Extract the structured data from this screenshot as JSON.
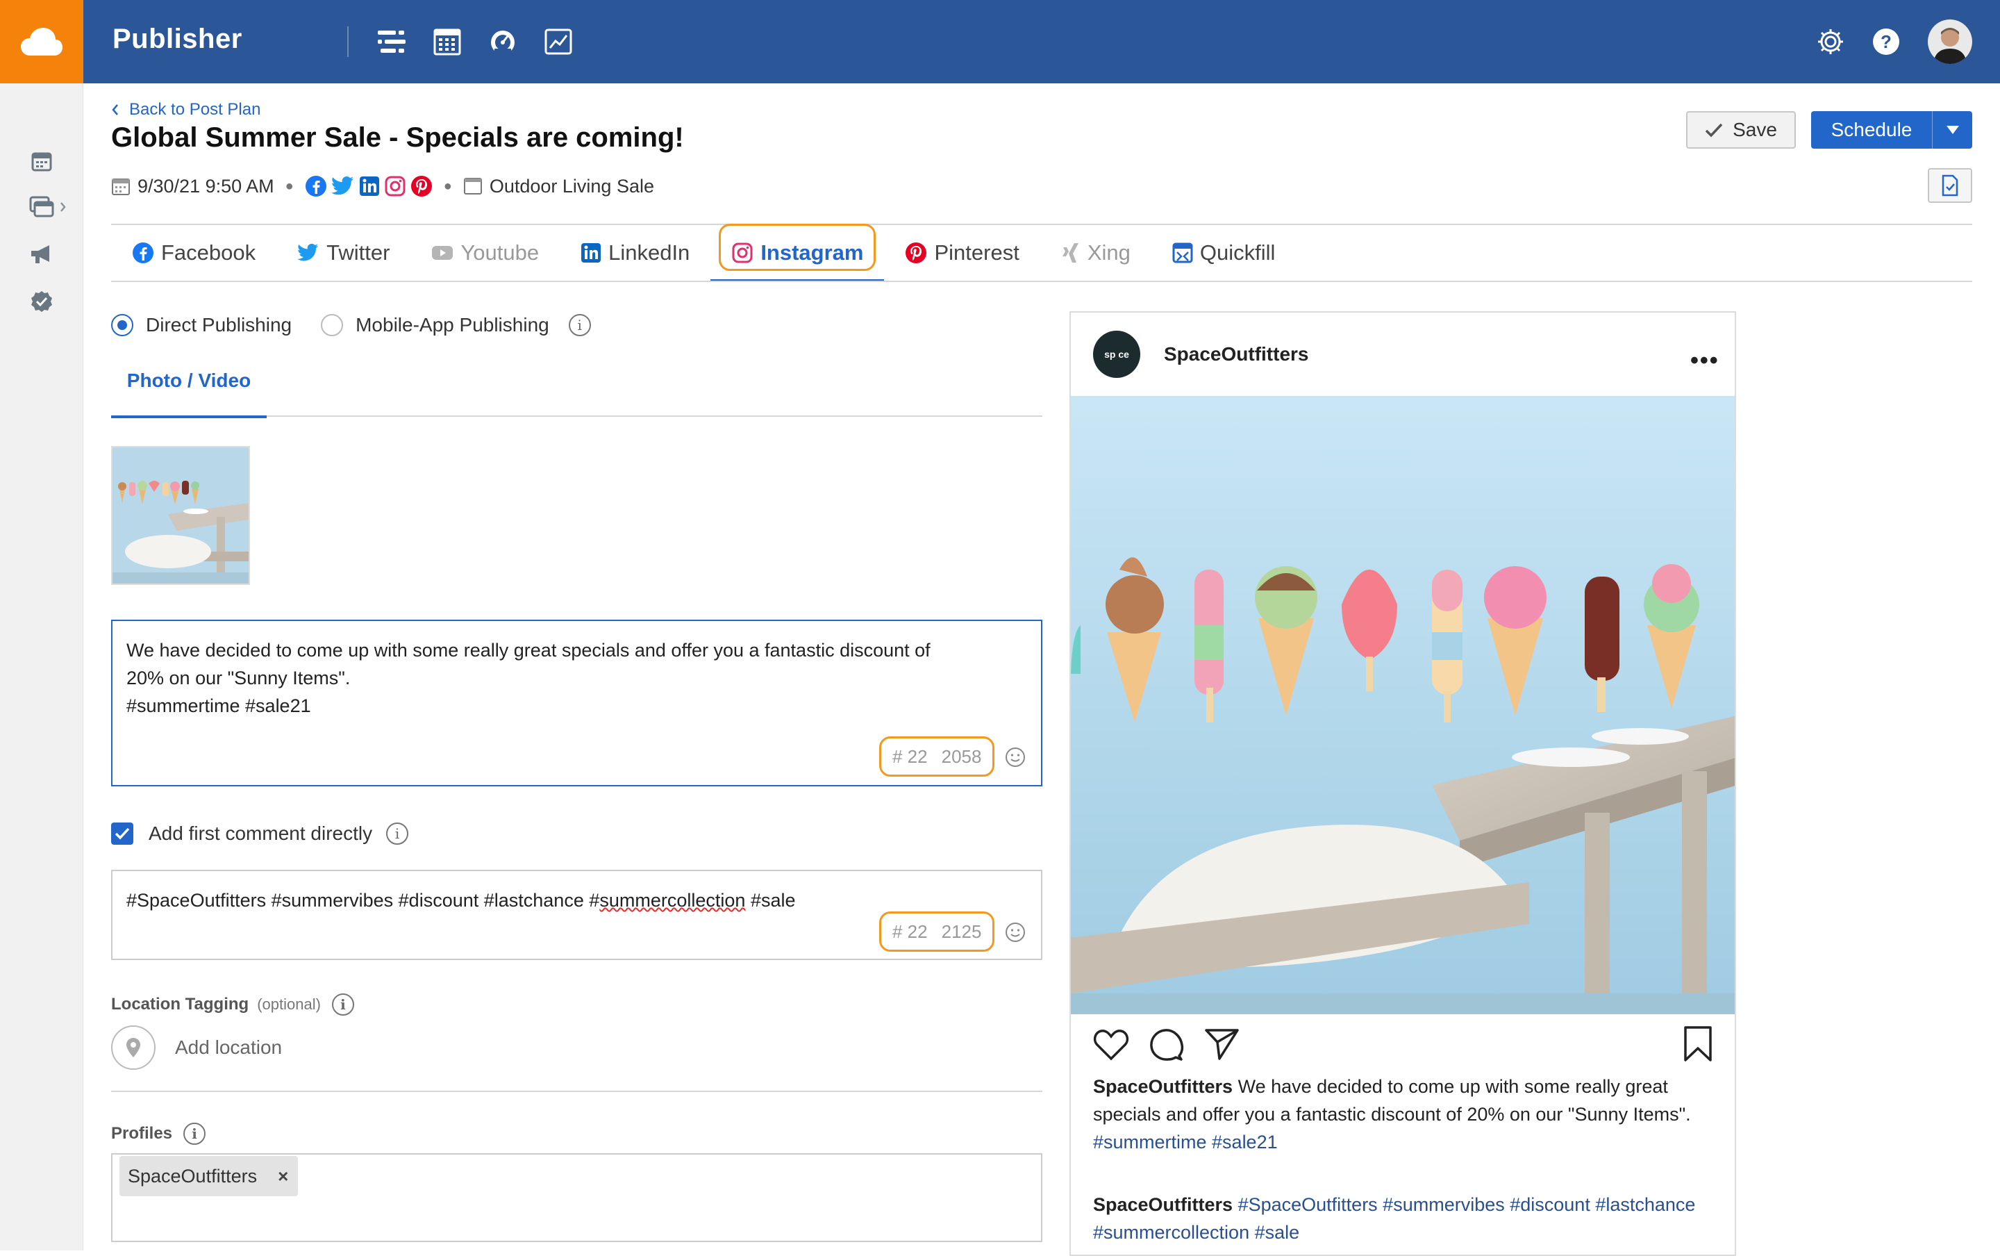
{
  "app": {
    "title": "Publisher"
  },
  "header": {
    "back_label": "Back to Post Plan",
    "title": "Global Summer Sale - Specials are coming!",
    "datetime": "9/30/21 9:50 AM",
    "campaign": "Outdoor Living Sale",
    "save_label": "Save",
    "schedule_label": "Schedule"
  },
  "tabs": [
    {
      "label": "Facebook",
      "icon": "facebook-icon",
      "state": "normal"
    },
    {
      "label": "Twitter",
      "icon": "twitter-icon",
      "state": "normal"
    },
    {
      "label": "Youtube",
      "icon": "youtube-icon",
      "state": "disabled"
    },
    {
      "label": "LinkedIn",
      "icon": "linkedin-icon",
      "state": "normal"
    },
    {
      "label": "Instagram",
      "icon": "instagram-icon",
      "state": "active"
    },
    {
      "label": "Pinterest",
      "icon": "pinterest-icon",
      "state": "normal"
    },
    {
      "label": "Xing",
      "icon": "xing-icon",
      "state": "disabled"
    },
    {
      "label": "Quickfill",
      "icon": "quickfill-icon",
      "state": "normal"
    }
  ],
  "publishing": {
    "direct_label": "Direct Publishing",
    "mobile_label": "Mobile-App Publishing",
    "selected": "direct"
  },
  "subtab": {
    "label": "Photo / Video"
  },
  "post": {
    "line1": "We have decided to come up with some really great specials and offer you a fantastic discount of",
    "line2": "20% on our \"Sunny Items\".",
    "line3": "#summertime #sale21",
    "hashtag_count": "# 22",
    "chars_left": "2058"
  },
  "first_comment": {
    "checkbox_label": "Add first comment directly",
    "checked": true,
    "text_before": "#SpaceOutfitters #summervibes #discount #lastchance #",
    "text_misspelled": "summercollection",
    "text_after": " #sale",
    "hashtag_count": "# 22",
    "chars_left": "2125"
  },
  "location": {
    "label": "Location Tagging",
    "optional": "(optional)",
    "placeholder": "Add location"
  },
  "profiles": {
    "label": "Profiles",
    "selected": [
      "SpaceOutfitters"
    ]
  },
  "preview": {
    "account": "SpaceOutfitters",
    "avatar_text": "sp ce",
    "more": "•••",
    "caption_text": "We have decided to come up with some really great specials and offer you a fantastic discount of 20% on our \"Sunny Items\".",
    "caption_tags": "#summertime #sale21",
    "comment_tags": "#SpaceOutfitters #summervibes #discount #lastchance #summercollection #sale"
  },
  "colors": {
    "topbar": "#2b5697",
    "logo_bg": "#f5820b",
    "accent": "#2266c9",
    "highlight": "#f39a1e"
  }
}
